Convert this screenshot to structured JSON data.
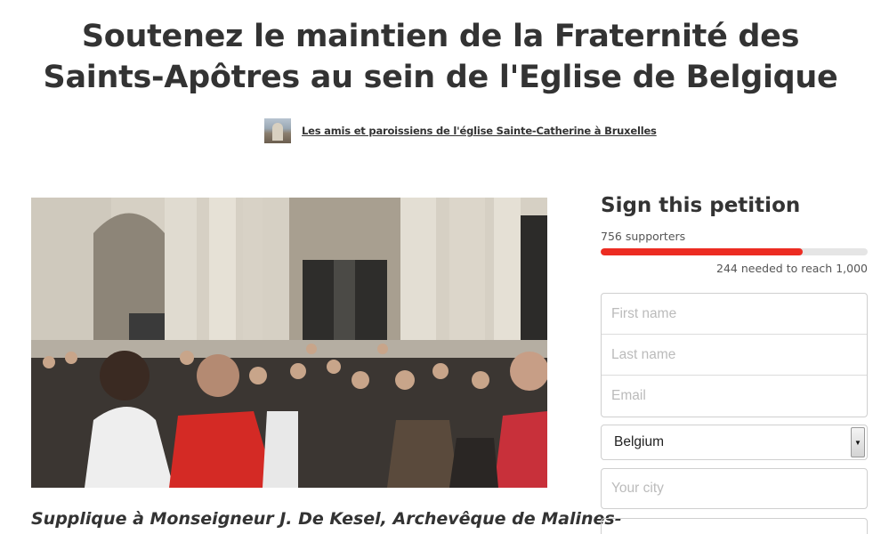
{
  "petition": {
    "title": "Soutenez le maintien de la Fraternité des Saints-Apôtres au sein de l'Eglise de Belgique",
    "author": "Les amis et paroissiens de l'église Sainte-Catherine à Bruxelles",
    "subtitle": "Supplique à Monseigneur J. De Kesel, Archevêque de Malines-"
  },
  "sign": {
    "title": "Sign this petition",
    "supporters_text": "756 supporters",
    "needed_text": "244 needed to reach 1,000",
    "supporters": 756,
    "goal": 1000,
    "progress_color": "#ec2c22"
  },
  "form": {
    "first_name_placeholder": "First name",
    "last_name_placeholder": "Last name",
    "email_placeholder": "Email",
    "country_value": "Belgium",
    "city_placeholder": "Your city"
  },
  "icons": {
    "author_avatar": "church-thumbnail",
    "select_arrow": "triangle-down-icon"
  }
}
